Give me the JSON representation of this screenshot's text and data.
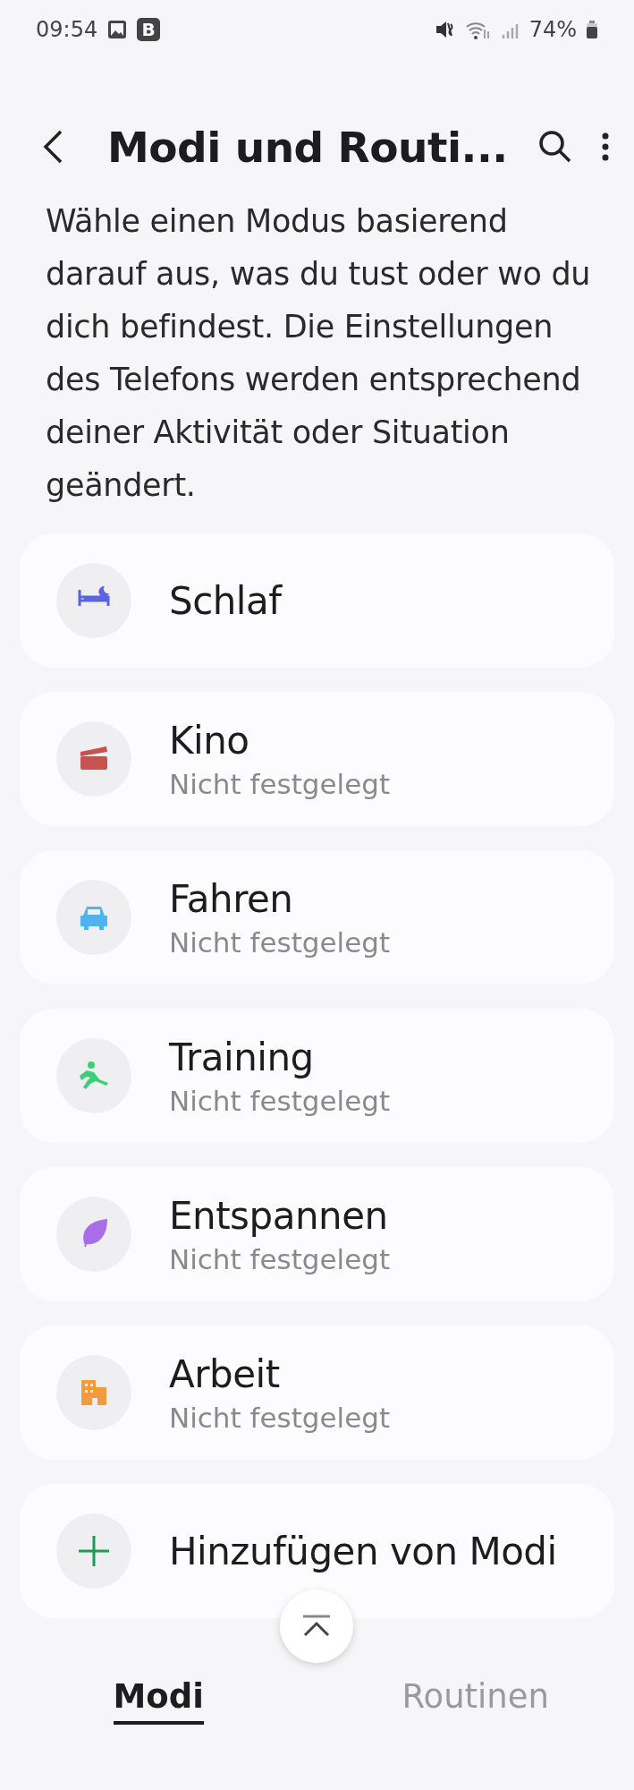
{
  "status_bar": {
    "time": "09:54",
    "badge": "B",
    "battery": "74%"
  },
  "header": {
    "title": "Modi und Routi..."
  },
  "description": "Wähle einen Modus basierend darauf aus, was du tust oder wo du dich befindest. Die Einstellungen des Telefons werden entsprechend deiner Aktivität oder Situation geändert.",
  "modes": [
    {
      "title": "Schlaf",
      "color": "#5a63e0"
    },
    {
      "title": "Kino",
      "subtitle": "Nicht festgelegt",
      "color": "#c9514f"
    },
    {
      "title": "Fahren",
      "subtitle": "Nicht festgelegt",
      "color": "#4fb3f0"
    },
    {
      "title": "Training",
      "subtitle": "Nicht festgelegt",
      "color": "#3ccf7a"
    },
    {
      "title": "Entspannen",
      "subtitle": "Nicht festgelegt",
      "color": "#a86ee8"
    },
    {
      "title": "Arbeit",
      "subtitle": "Nicht festgelegt",
      "color": "#f39a3c"
    }
  ],
  "add_mode": {
    "title": "Hinzufügen von Modi"
  },
  "tabs": [
    {
      "label": "Modi",
      "selected": true
    },
    {
      "label": "Routinen",
      "selected": false
    }
  ]
}
